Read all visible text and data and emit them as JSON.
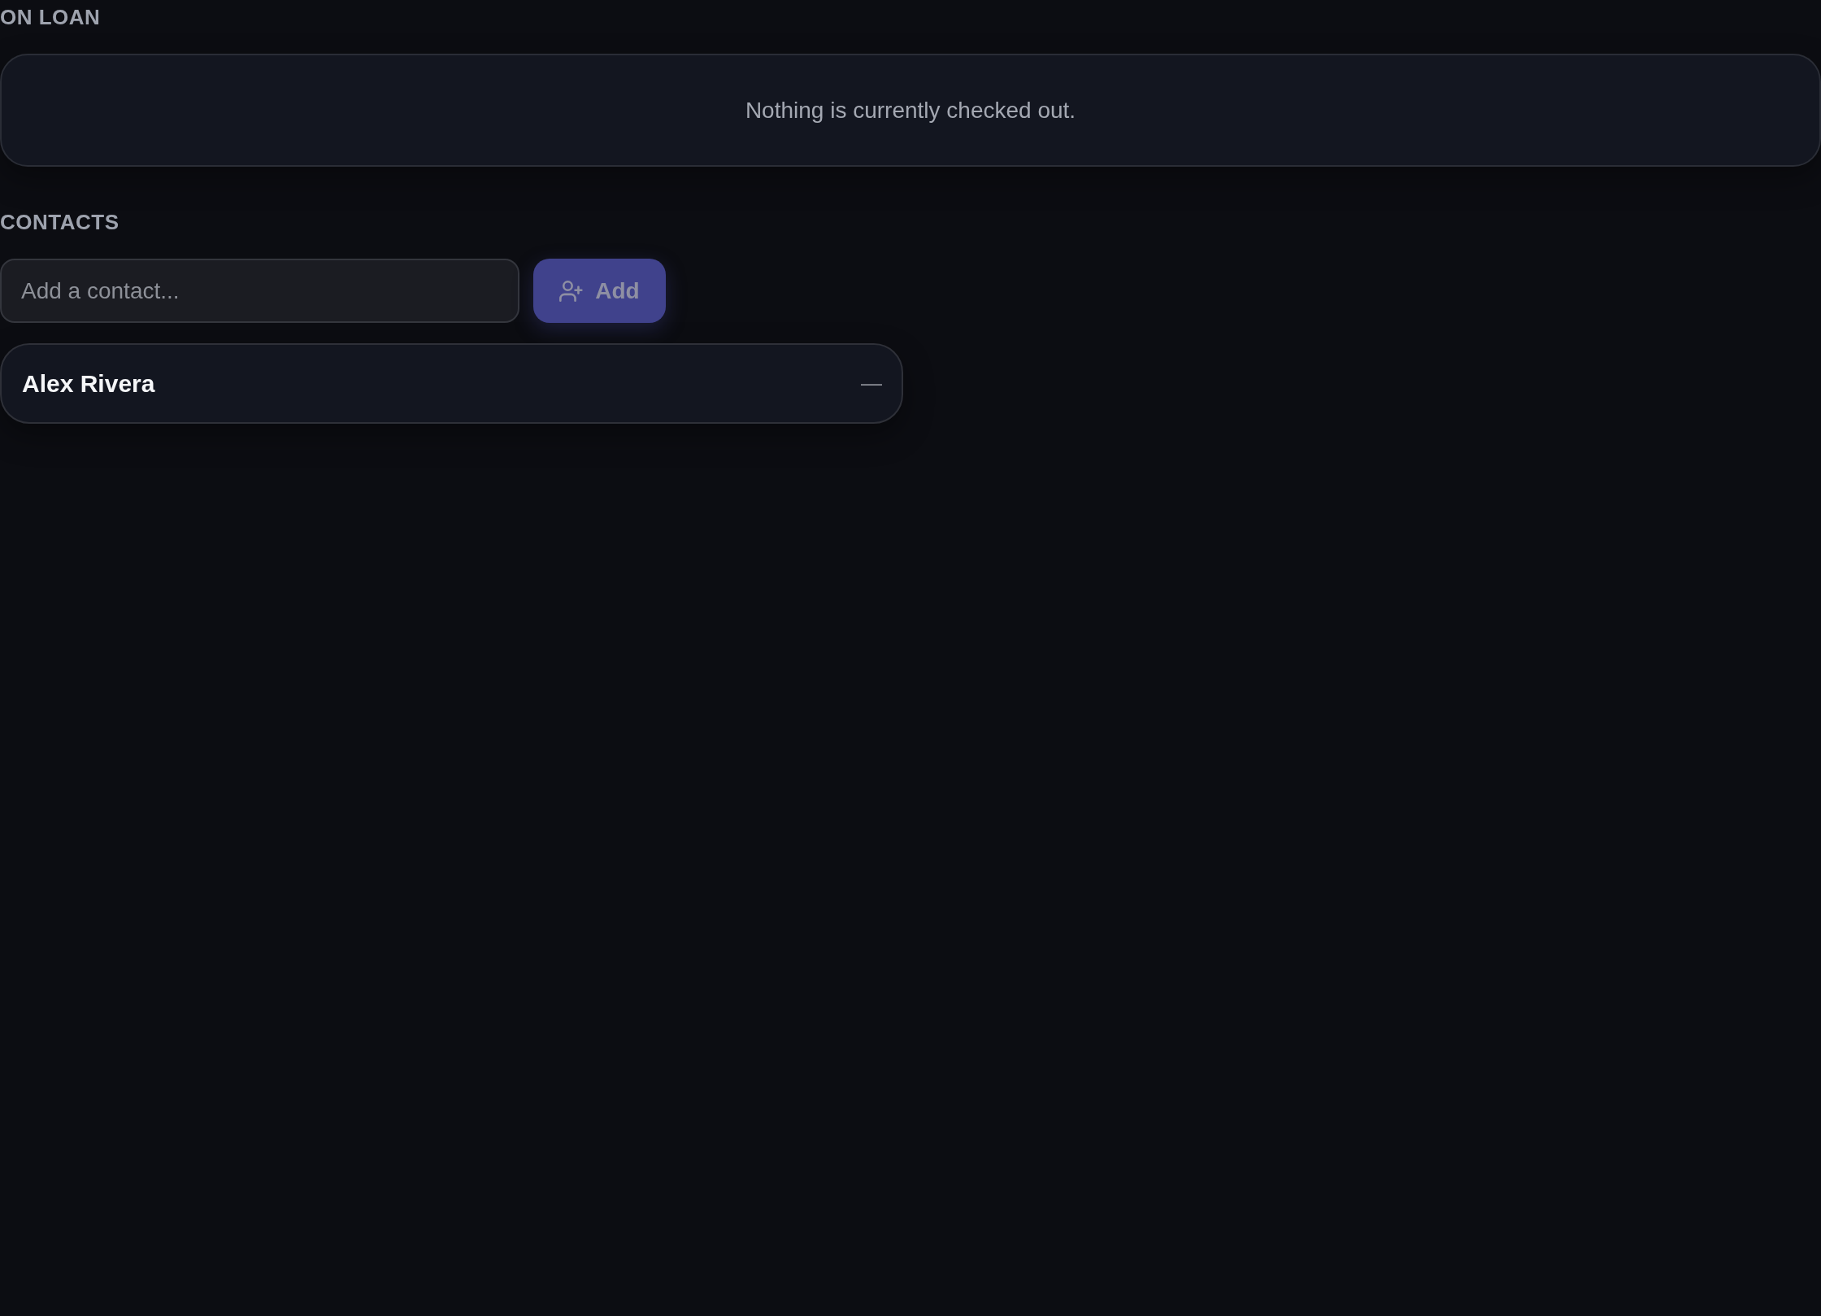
{
  "on_loan": {
    "heading": "ON LOAN",
    "empty_message": "Nothing is currently checked out."
  },
  "contacts": {
    "heading": "CONTACTS",
    "add_field": {
      "placeholder": "Add a contact..."
    },
    "add_button": {
      "label": "Add",
      "disabled": true
    },
    "items": [
      {
        "name": "Alex Rivera",
        "note": "—"
      }
    ]
  }
}
